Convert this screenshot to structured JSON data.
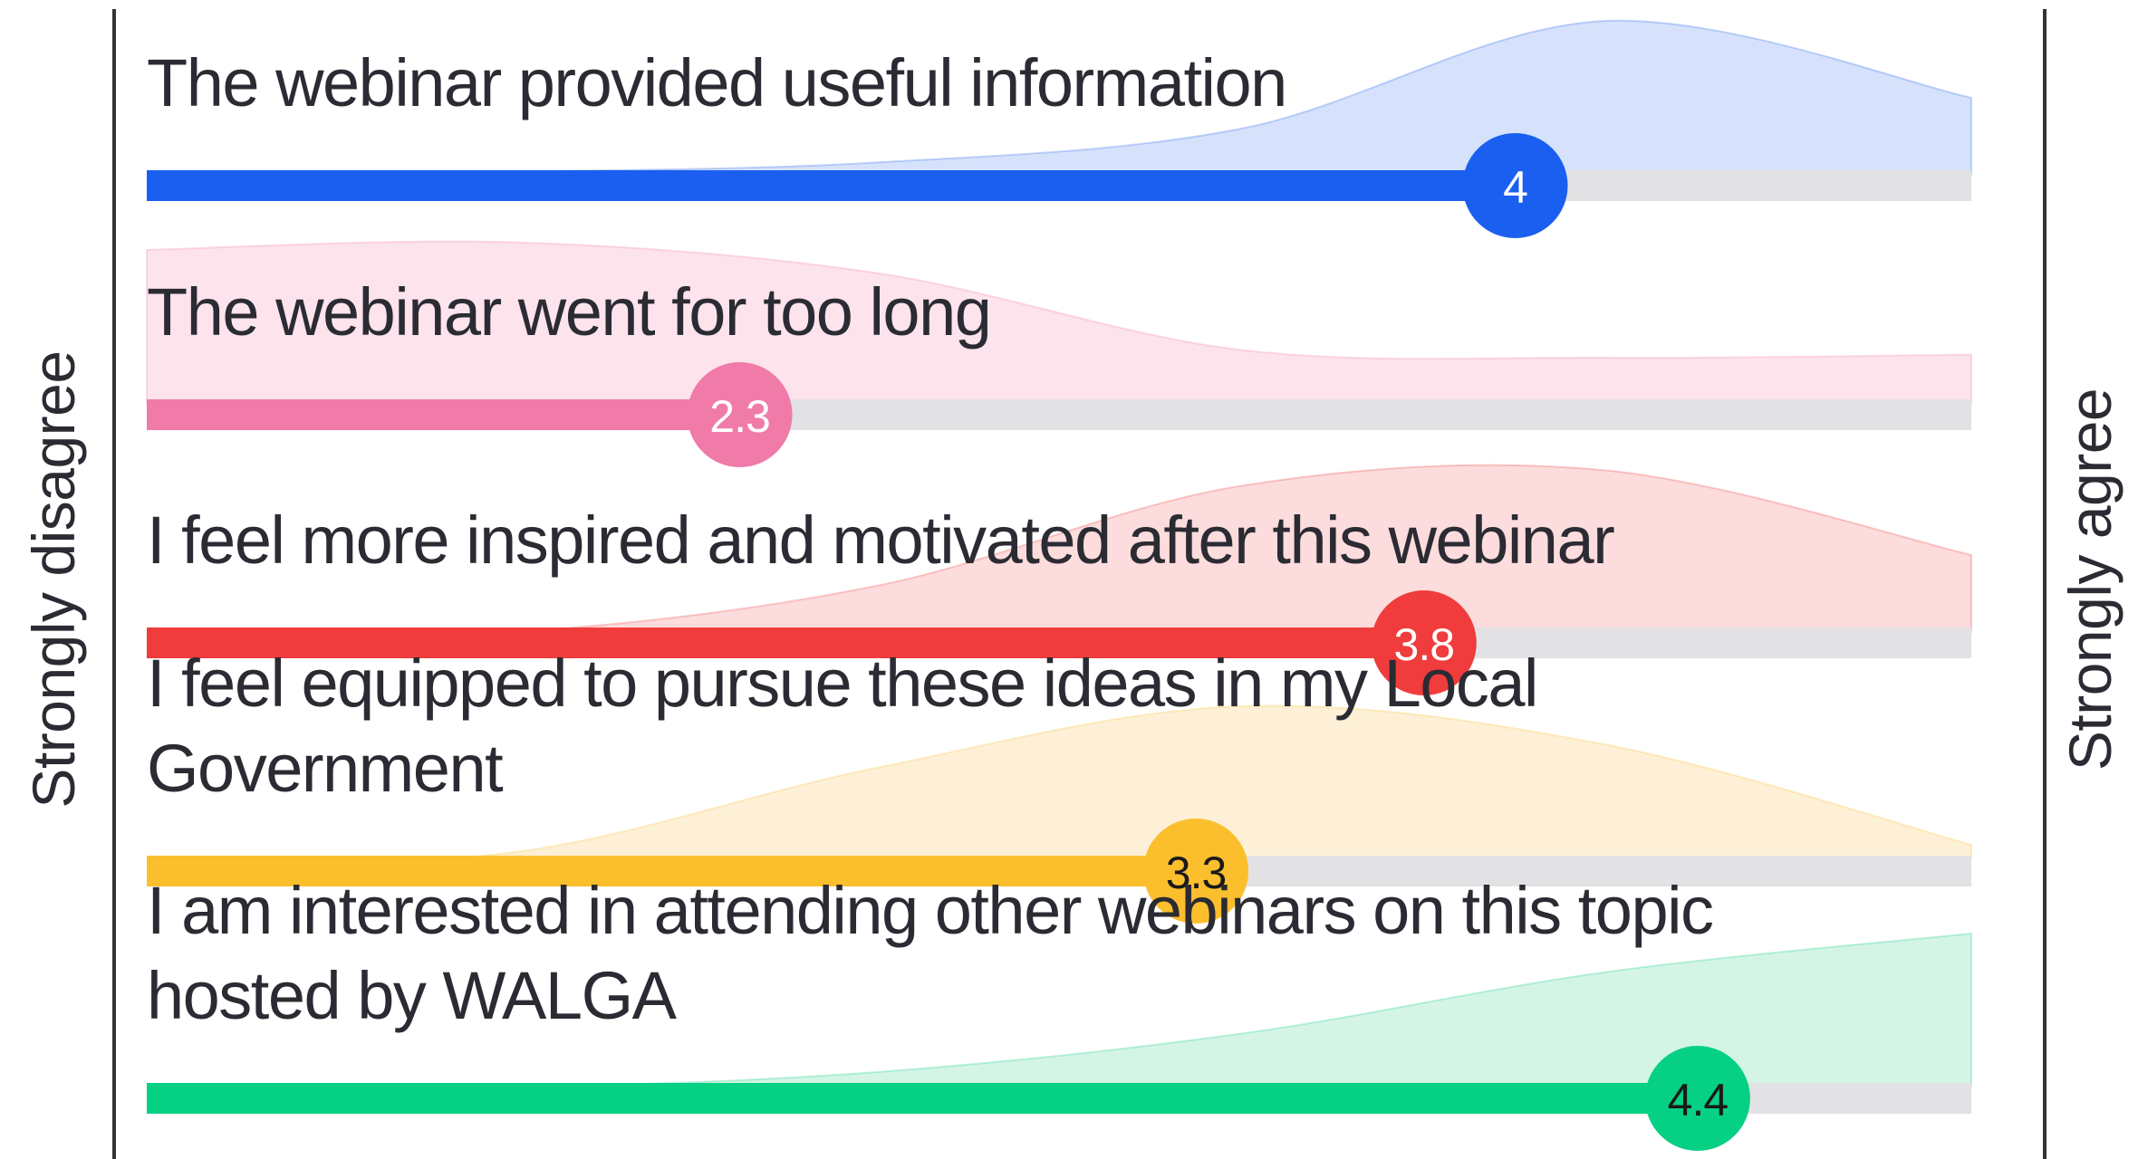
{
  "chart_data": {
    "type": "bar",
    "scale": {
      "min": 1,
      "max": 5
    },
    "left_label": "Strongly disagree",
    "right_label": "Strongly agree",
    "series": [
      {
        "statement": [
          "The webinar provided useful information"
        ],
        "value": 4,
        "value_label": "4",
        "color": "#1a5ff0",
        "fill": "#d6e2fb",
        "text_color": "#ffffff",
        "distribution": [
          0.0,
          0.02,
          0.08,
          0.3,
          1.0,
          0.5
        ]
      },
      {
        "statement": [
          "The webinar went for too long"
        ],
        "value": 2.3,
        "value_label": "2.3",
        "color": "#f07aa8",
        "fill": "#fde3ec",
        "text_color": "#ffffff",
        "distribution": [
          1.0,
          1.05,
          0.85,
          0.35,
          0.3,
          0.32
        ]
      },
      {
        "statement": [
          "I feel more inspired and motivated after this webinar"
        ],
        "value": 3.8,
        "value_label": "3.8",
        "color": "#f03c3c",
        "fill": "#fcdcdc",
        "text_color": "#ffffff",
        "distribution": [
          0.0,
          0.0,
          0.3,
          0.95,
          1.05,
          0.5
        ]
      },
      {
        "statement": [
          "I feel equipped to pursue these ideas in my Local",
          "Government"
        ],
        "value": 3.3,
        "value_label": "3.3",
        "color": "#fbbf2e",
        "fill": "#fdf0d6",
        "text_color": "#1a1a1a",
        "distribution": [
          0.0,
          0.05,
          0.6,
          1.0,
          0.75,
          0.1
        ]
      },
      {
        "statement": [
          "I am interested in attending other webinars on this topic",
          "hosted by WALGA"
        ],
        "value": 4.4,
        "value_label": "4.4",
        "color": "#06d084",
        "fill": "#d4f5e6",
        "text_color": "#1a1a1a",
        "distribution": [
          0.0,
          0.0,
          0.1,
          0.35,
          0.75,
          1.0
        ]
      }
    ]
  }
}
